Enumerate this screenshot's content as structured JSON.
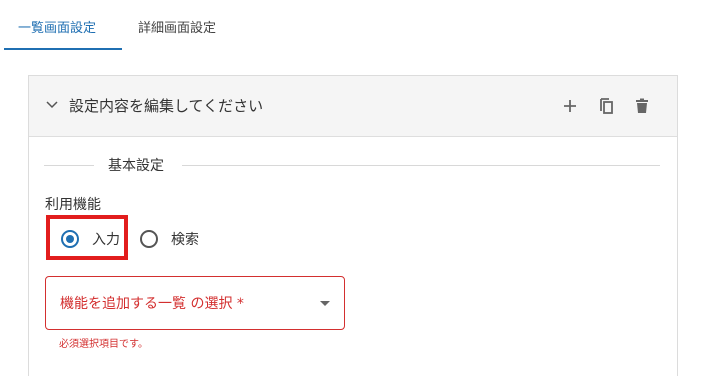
{
  "tabs": [
    {
      "label": "一覧画面設定",
      "active": true
    },
    {
      "label": "詳細画面設定",
      "active": false
    }
  ],
  "panel": {
    "title": "設定内容を編集してください",
    "actions": [
      "plus-icon",
      "copy-icon",
      "trash-icon"
    ]
  },
  "section": {
    "title": "基本設定"
  },
  "field": {
    "label": "利用機能",
    "options": [
      {
        "label": "入力",
        "selected": true
      },
      {
        "label": "検索",
        "selected": false
      }
    ]
  },
  "select": {
    "label": "機能を追加する一覧 の選択 *",
    "helper": "必須選択項目です。"
  },
  "colors": {
    "accent": "#1f6fb2",
    "error": "#d32f2f",
    "highlight": "#e21d1d"
  }
}
